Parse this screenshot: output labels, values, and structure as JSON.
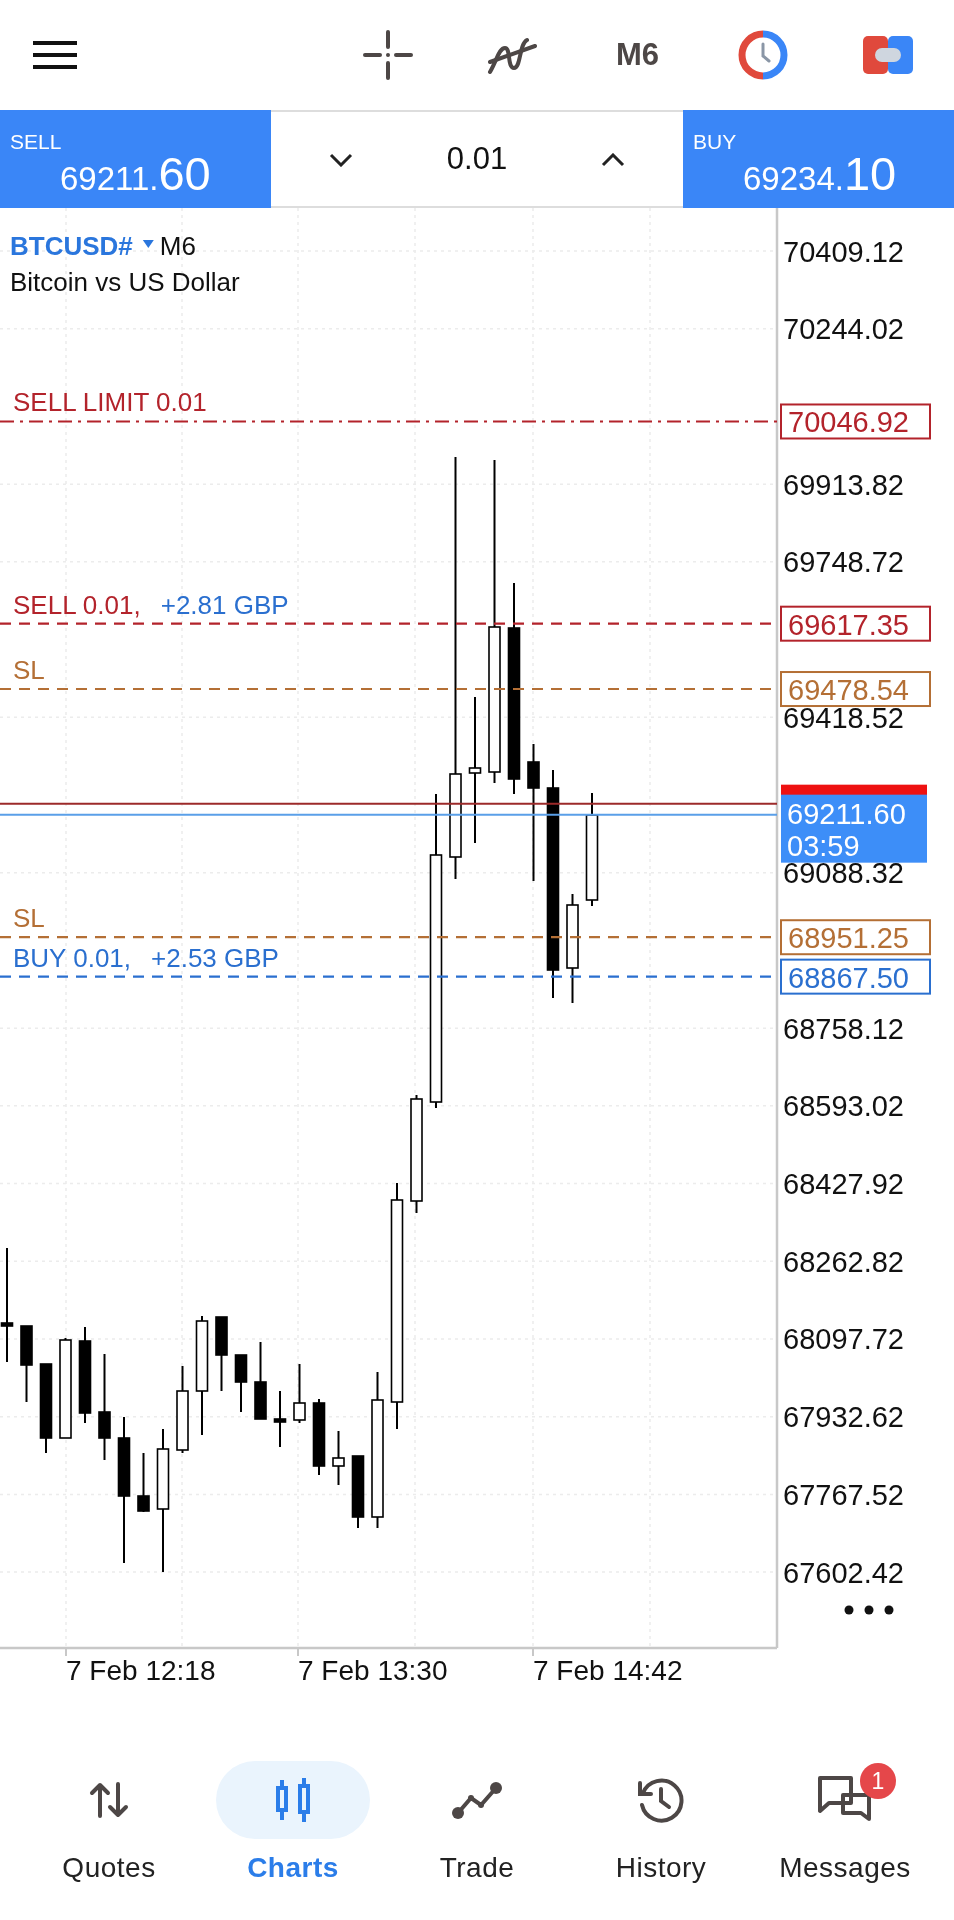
{
  "toolbar": {
    "timeframe": "M6"
  },
  "quote": {
    "sell": {
      "label": "SELL",
      "price_head": "69211.",
      "price_tail": "60"
    },
    "volume": "0.01",
    "buy": {
      "label": "BUY",
      "price_head": "69234.",
      "price_tail": "10"
    }
  },
  "chart": {
    "symbol": "BTCUSD#",
    "timeframe": "M6",
    "description": "Bitcoin vs US Dollar",
    "price_labels": [
      "70409.12",
      "70244.02",
      "69913.82",
      "69748.72",
      "69418.52",
      "69088.32",
      "68758.12",
      "68593.02",
      "68427.92",
      "68262.82",
      "68097.72",
      "67932.62",
      "67767.52",
      "67602.42"
    ],
    "order_lines": [
      {
        "kind": "pending",
        "label": "SELL LIMIT 0.01",
        "price": "70046.92",
        "color": "#b3232b"
      },
      {
        "kind": "position",
        "label": "SELL 0.01,",
        "profit": "+2.81 GBP",
        "price": "69617.35",
        "color": "#b3232b"
      },
      {
        "kind": "stop_loss",
        "label": "SL",
        "price": "69478.54",
        "color": "#b46f35"
      },
      {
        "kind": "stop_loss",
        "label": "SL",
        "price": "68951.25",
        "color": "#b46f35"
      },
      {
        "kind": "position",
        "label": "BUY 0.01,",
        "profit": "+2.53 GBP",
        "price": "68867.50",
        "color": "#2a6fcf"
      }
    ],
    "bid": {
      "price": "69211.60",
      "countdown": "03:59"
    },
    "time_labels": [
      "7 Feb 12:18",
      "7 Feb 13:30",
      "7 Feb 14:42"
    ]
  },
  "nav": [
    {
      "label": "Quotes",
      "selected": false
    },
    {
      "label": "Charts",
      "selected": true
    },
    {
      "label": "Trade",
      "selected": false
    },
    {
      "label": "History",
      "selected": false
    },
    {
      "label": "Messages",
      "selected": false,
      "badge": "1"
    }
  ]
}
